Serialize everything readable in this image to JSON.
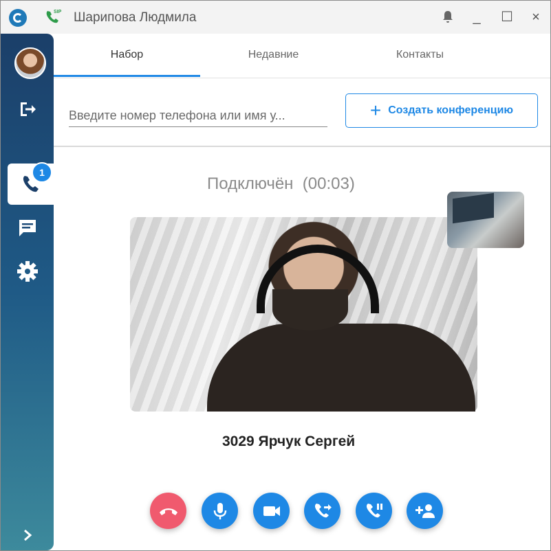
{
  "window": {
    "title": "Шарипова Людмила",
    "controls": {
      "bell": "bell-icon",
      "minimize": "_",
      "maximize": "☐",
      "close": "×"
    },
    "sip_label": "SIP"
  },
  "sidebar": {
    "items": [
      {
        "name": "avatar"
      },
      {
        "name": "logout-icon"
      },
      {
        "name": "phone-icon",
        "badge": "1",
        "active": true
      },
      {
        "name": "chat-icon"
      },
      {
        "name": "gear-icon"
      },
      {
        "name": "chevron-right-icon"
      }
    ]
  },
  "tabs": [
    {
      "label": "Набор",
      "active": true
    },
    {
      "label": "Недавние"
    },
    {
      "label": "Контакты"
    }
  ],
  "search": {
    "placeholder": "Введите номер телефона или имя у..."
  },
  "conference_button": {
    "label": "Создать конференцию"
  },
  "call": {
    "status": "Подключён",
    "timer": "(00:03)",
    "caller_name": "3029 Ярчук Сергей"
  },
  "controls": [
    {
      "name": "hangup-button",
      "color": "#f05a6e"
    },
    {
      "name": "mute-mic-button",
      "color": "#1e88e5"
    },
    {
      "name": "video-button",
      "color": "#1e88e5"
    },
    {
      "name": "transfer-call-button",
      "color": "#1e88e5"
    },
    {
      "name": "hold-call-button",
      "color": "#1e88e5"
    },
    {
      "name": "add-participant-button",
      "color": "#1e88e5"
    }
  ],
  "colors": {
    "accent": "#1e88e5",
    "hangup": "#f05a6e",
    "sidebar_top": "#1b3f69",
    "sidebar_bottom": "#3d8a9c"
  }
}
